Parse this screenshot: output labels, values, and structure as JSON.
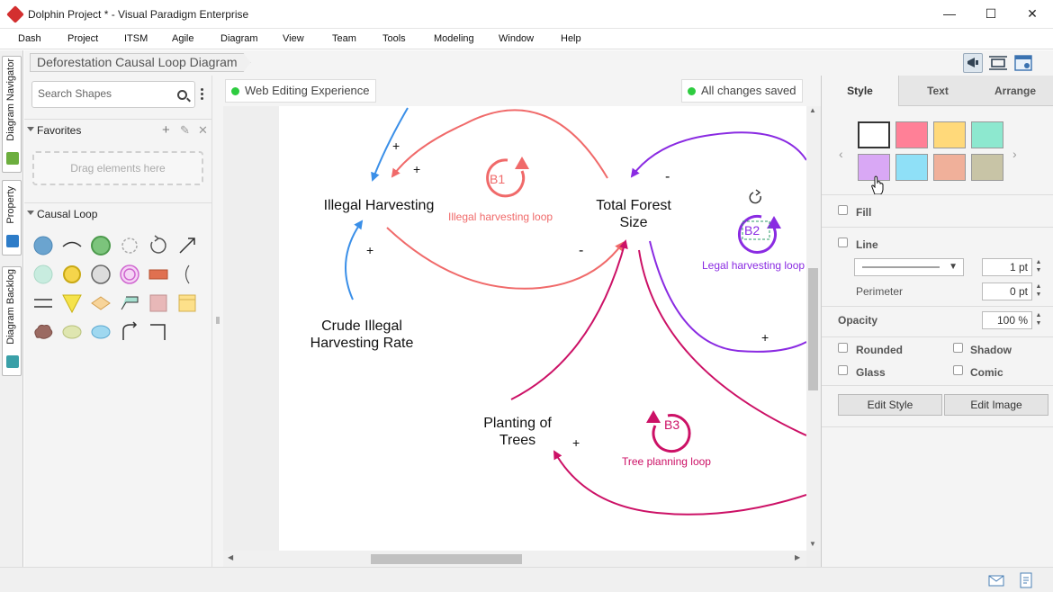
{
  "window": {
    "title": "Dolphin Project * - Visual Paradigm Enterprise",
    "minimize": "—",
    "maximize": "☐",
    "close": "✕"
  },
  "menu": [
    "Dash",
    "Project",
    "ITSM",
    "Agile",
    "Diagram",
    "View",
    "Team",
    "Tools",
    "Modeling",
    "Window",
    "Help"
  ],
  "left_tabs": [
    "Diagram Navigator",
    "Property",
    "Diagram Backlog"
  ],
  "breadcrumb": "Deforestation Causal Loop Diagram",
  "shapes_panel": {
    "search_placeholder": "Search Shapes",
    "favorites_label": "Favorites",
    "favorites_actions": [
      "+",
      "✎",
      "✕"
    ],
    "dropzone_text": "Drag elements here",
    "causal_loop_label": "Causal Loop"
  },
  "canvas": {
    "web_editing": "Web Editing Experience",
    "save_status": "All changes saved",
    "nodes": [
      {
        "id": "illegal-harvesting",
        "text": "Illegal Harvesting"
      },
      {
        "id": "total-forest-size",
        "text": "Total Forest\nSize"
      },
      {
        "id": "crude-illegal-harvesting-rate",
        "text": "Crude Illegal\nHarvesting Rate"
      },
      {
        "id": "planting-of-trees",
        "text": "Planting of\nTrees"
      }
    ],
    "loops": [
      {
        "id": "b1",
        "badge": "B1",
        "label": "Illegal harvesting loop",
        "color": "#f06a6a"
      },
      {
        "id": "b2",
        "badge": "B2",
        "label": "Legal harvesting loop",
        "color": "#8a2be2"
      },
      {
        "id": "b3",
        "badge": "B3",
        "label": "Tree planning loop",
        "color": "#cc1166"
      }
    ],
    "signs": [
      "+",
      "+",
      "+",
      "-",
      "-",
      "+",
      "+"
    ]
  },
  "props": {
    "tabs": [
      "Style",
      "Text",
      "Arrange"
    ],
    "active_tab": "Style",
    "swatches": [
      "#ffffff",
      "#ff8097",
      "#ffd97a",
      "#8de8cf",
      "#d9a8f5",
      "#8fe0f7",
      "#f0b09a",
      "#c8c4a6"
    ],
    "fill_label": "Fill",
    "line_label": "Line",
    "line_width": "1 pt",
    "perimeter_label": "Perimeter",
    "perimeter_value": "0 pt",
    "opacity_label": "Opacity",
    "opacity_value": "100 %",
    "rounded_label": "Rounded",
    "shadow_label": "Shadow",
    "glass_label": "Glass",
    "comic_label": "Comic",
    "edit_style": "Edit Style",
    "edit_image": "Edit Image"
  },
  "colors": {
    "accent_green": "#2ecc40",
    "b1_red": "#f06a6a",
    "b2_purple": "#8a2be2",
    "b3_magenta": "#cc1166",
    "link_blue": "#3a8fe8"
  }
}
